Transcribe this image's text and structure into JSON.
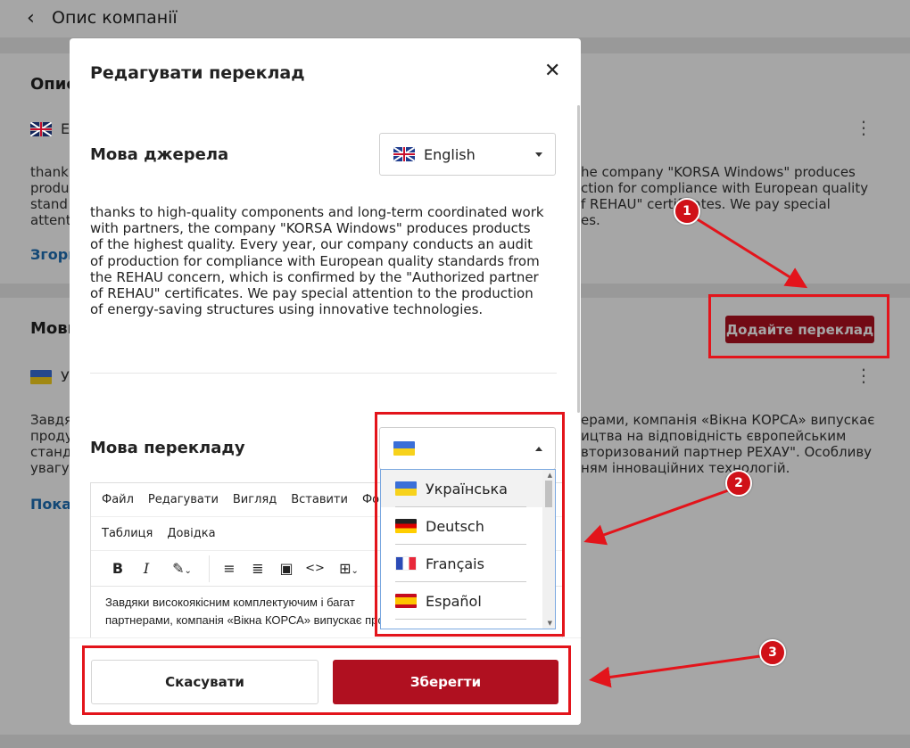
{
  "background": {
    "page_title": "Опис компанії",
    "card1": {
      "title": "Опис",
      "lang_code": "E",
      "text_lines": [
        "thank",
        "produ",
        "stand",
        "attent"
      ],
      "text_right_lines": [
        "he company \"KORSA Windows\" produces",
        "ction for compliance with European quality",
        "f REHAU\" certificates. We pay special",
        "es."
      ],
      "link": "Згорн"
    },
    "card2": {
      "title": "Мови",
      "lang_code": "У",
      "add_translation_button": "Додайте переклад",
      "text_lines": [
        "Завдя",
        "проду",
        "станд",
        "увагу"
      ],
      "text_right_lines": [
        "ерами, компанія «Вікна КОРСА» випускає",
        "ицтва на відповідність європейським",
        "вторизований партнер РЕХАУ\". Особливу",
        "ням інноваційних технологій."
      ],
      "link": "Показ"
    }
  },
  "modal": {
    "title": "Редагувати переклад",
    "source_label": "Мова джерела",
    "source_language": "English",
    "source_text": "thanks to high-quality components and long-term coordinated work with partners, the company \"KORSA Windows\" produces products of the highest quality. Every year, our company conducts an audit of production for compliance with European quality standards from the REHAU concern, which is confirmed by the \"Authorized partner of REHAU\" certificates. We pay special attention to the production of energy-saving structures using innovative technologies.",
    "target_label": "Мова перекладу",
    "editor": {
      "menu": [
        "Файл",
        "Редагувати",
        "Вигляд",
        "Вставити",
        "Фор"
      ],
      "menu2": [
        "Таблиця",
        "Довідка"
      ],
      "tools": [
        "B",
        "I"
      ],
      "body_line1": "Завдяки високоякісним комплектуючим і багат",
      "body_line2": "партнерами, компанія «Вікна КОРСА» випускає продукцію максимальної"
    },
    "language_options": [
      {
        "label": "Українська",
        "flag": "ua"
      },
      {
        "label": "Deutsch",
        "flag": "de"
      },
      {
        "label": "Français",
        "flag": "fr"
      },
      {
        "label": "Español",
        "flag": "es"
      }
    ],
    "cancel_button": "Скасувати",
    "save_button": "Зберегти"
  },
  "annotations": {
    "badges": [
      "1",
      "2",
      "3"
    ],
    "color": "#e3141b"
  }
}
